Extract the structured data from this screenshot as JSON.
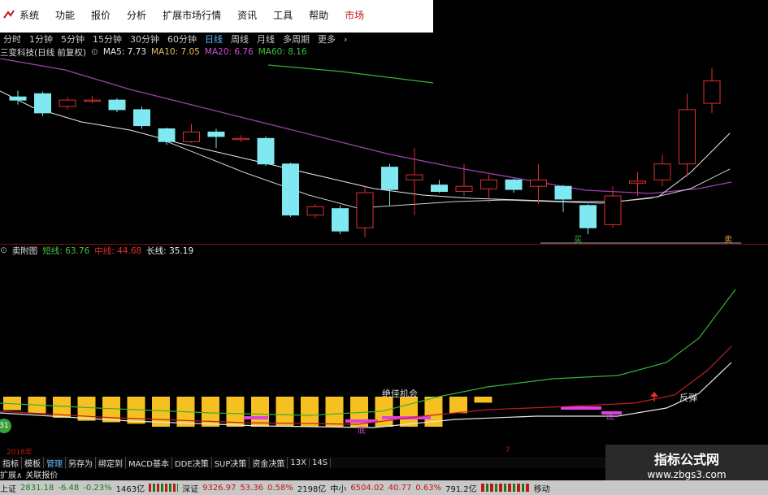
{
  "menu": {
    "items": [
      "系统",
      "功能",
      "报价",
      "分析",
      "扩展市场行情",
      "资讯",
      "工具",
      "帮助",
      "市场"
    ]
  },
  "periods": {
    "items": [
      "分时",
      "1分钟",
      "5分钟",
      "15分钟",
      "30分钟",
      "60分钟",
      "日线",
      "周线",
      "月线",
      "多周期",
      "更多"
    ],
    "active": "日线"
  },
  "main_chart": {
    "title": "三变科技(日线 前复权)",
    "ma5": "MA5: 7.73",
    "ma10": "MA10: 7.05",
    "ma20": "MA20: 6.76",
    "ma60": "MA60: 8.16",
    "candles": [
      {
        "o": 7.1,
        "c": 7.05,
        "h": 7.2,
        "l": 6.98
      },
      {
        "o": 7.15,
        "c": 6.85,
        "h": 7.18,
        "l": 6.8
      },
      {
        "o": 6.95,
        "c": 7.05,
        "h": 7.1,
        "l": 6.9
      },
      {
        "o": 7.05,
        "c": 7.05,
        "h": 7.12,
        "l": 7.0
      },
      {
        "o": 7.05,
        "c": 6.9,
        "h": 7.08,
        "l": 6.86
      },
      {
        "o": 6.9,
        "c": 6.65,
        "h": 6.95,
        "l": 6.6
      },
      {
        "o": 6.6,
        "c": 6.4,
        "h": 6.62,
        "l": 6.35
      },
      {
        "o": 6.4,
        "c": 6.55,
        "h": 6.68,
        "l": 6.38
      },
      {
        "o": 6.55,
        "c": 6.48,
        "h": 6.6,
        "l": 6.3
      },
      {
        "o": 6.45,
        "c": 6.45,
        "h": 6.5,
        "l": 6.4
      },
      {
        "o": 6.45,
        "c": 6.05,
        "h": 6.48,
        "l": 6.02
      },
      {
        "o": 6.05,
        "c": 5.25,
        "h": 6.07,
        "l": 5.22
      },
      {
        "o": 5.25,
        "c": 5.38,
        "h": 5.42,
        "l": 5.2
      },
      {
        "o": 5.35,
        "c": 5.0,
        "h": 5.4,
        "l": 4.95
      },
      {
        "o": 5.05,
        "c": 5.6,
        "h": 5.7,
        "l": 4.9
      },
      {
        "o": 6.0,
        "c": 5.65,
        "h": 6.05,
        "l": 5.4
      },
      {
        "o": 5.8,
        "c": 5.88,
        "h": 6.3,
        "l": 5.25
      },
      {
        "o": 5.72,
        "c": 5.62,
        "h": 5.8,
        "l": 5.6
      },
      {
        "o": 5.62,
        "c": 5.7,
        "h": 6.05,
        "l": 5.55
      },
      {
        "o": 5.66,
        "c": 5.8,
        "h": 5.88,
        "l": 5.45
      },
      {
        "o": 5.8,
        "c": 5.65,
        "h": 5.82,
        "l": 5.6
      },
      {
        "o": 5.7,
        "c": 5.8,
        "h": 6.05,
        "l": 5.42
      },
      {
        "o": 5.7,
        "c": 5.5,
        "h": 5.72,
        "l": 5.3
      },
      {
        "o": 5.4,
        "c": 5.05,
        "h": 5.42,
        "l": 4.95
      },
      {
        "o": 5.1,
        "c": 5.55,
        "h": 5.7,
        "l": 5.05
      },
      {
        "o": 5.75,
        "c": 5.78,
        "h": 5.92,
        "l": 5.55
      },
      {
        "o": 5.8,
        "c": 6.05,
        "h": 6.2,
        "l": 5.7
      },
      {
        "o": 6.05,
        "c": 6.9,
        "h": 7.15,
        "l": 5.85
      },
      {
        "o": 7.0,
        "c": 7.35,
        "h": 7.55,
        "l": 6.85
      }
    ],
    "signals": {
      "buy": "买",
      "sell": "卖"
    }
  },
  "sub_chart": {
    "title": "卖附图",
    "short_line": "短线: 63.76",
    "mid_line": "中线: 44.68",
    "long_line": "长线: 35.19",
    "label_jdc": "绝佳机会",
    "label_fan": "反弹",
    "label_di": "底",
    "bar_heights": [
      0.45,
      0.55,
      0.7,
      0.8,
      0.85,
      0.9,
      1.0,
      1.0,
      1.0,
      1.0,
      1.0,
      1.0,
      1.0,
      1.0,
      1.0,
      1.0,
      1.0,
      1.0,
      0.55,
      0.2
    ]
  },
  "bottom": {
    "year": "2018年",
    "tick7": "7",
    "tabs": [
      "指标",
      "模板",
      "管理",
      "另存为",
      "绑定到",
      "MACD基本",
      "DDE决策",
      "SUP决策",
      "资金决策",
      "13X",
      "14S"
    ],
    "active_tab": "管理",
    "extra": [
      "扩展∧",
      "关联报价"
    ],
    "badge": "31"
  },
  "status": {
    "sh_label": "上证",
    "sh_value": "2831.18",
    "sh_chg": "-6.48",
    "sh_pct": "-0.23%",
    "sh_amt": "1463亿",
    "sz_label": "深证",
    "sz_value": "9326.97",
    "sz_chg": "53.36",
    "sz_pct": "0.58%",
    "sz_amt": "2198亿",
    "zx_label": "中小",
    "zx_value": "6504.02",
    "zx_chg": "40.77",
    "zx_pct": "0.63%",
    "zx_amt": "791.2亿",
    "mobile": "移动"
  },
  "watermark": {
    "title": "指标公式网",
    "url": "www.zbgs3.com"
  },
  "colors": {
    "up": "#e03030",
    "down": "#7fe8f0",
    "ma5": "#e8e8e8",
    "ma10": "#e0c060",
    "ma20": "#c040c0",
    "ma60": "#3ab03a",
    "bar": "#f5c020",
    "magenta": "#e040e0"
  }
}
